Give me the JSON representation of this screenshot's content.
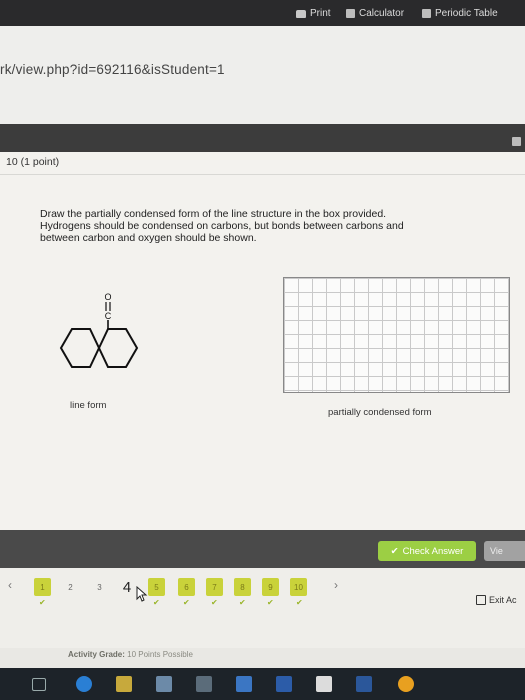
{
  "url": "rk/view.php?id=692116&isStudent=1",
  "toolbar": {
    "print": "Print",
    "calculator": "Calculator",
    "periodic_table": "Periodic Table"
  },
  "question": {
    "header": "10 (1 point)",
    "prompt": [
      "Draw the partially condensed form of the line structure in the box provided.",
      "Hydrogens should be condensed on carbons, but bonds between carbons and",
      "between carbon and oxygen should be shown."
    ],
    "molecule_labels": {
      "oxygen": "O",
      "carbon": "C"
    },
    "line_form_label": "line form",
    "partially_condensed_label": "partially condensed form"
  },
  "actions": {
    "check_answer": "Check Answer",
    "view": "Vie"
  },
  "navigation": {
    "prev": "‹",
    "next": "›",
    "pages": [
      {
        "label": "1",
        "state": "done"
      },
      {
        "label": "2",
        "state": "plain"
      },
      {
        "label": "3",
        "state": "plain"
      },
      {
        "label": "4",
        "state": "current"
      },
      {
        "label": "5",
        "state": "done"
      },
      {
        "label": "6",
        "state": "done"
      },
      {
        "label": "7",
        "state": "done"
      },
      {
        "label": "8",
        "state": "done"
      },
      {
        "label": "9",
        "state": "done"
      },
      {
        "label": "10",
        "state": "done"
      }
    ],
    "exit": "Exit Ac"
  },
  "grade": {
    "label": "Activity Grade:",
    "value": "10 Points Possible"
  },
  "colors": {
    "check_green": "#9ccf44",
    "page_done": "#c9d23a",
    "toolbar_bg": "#3c3c3c"
  }
}
